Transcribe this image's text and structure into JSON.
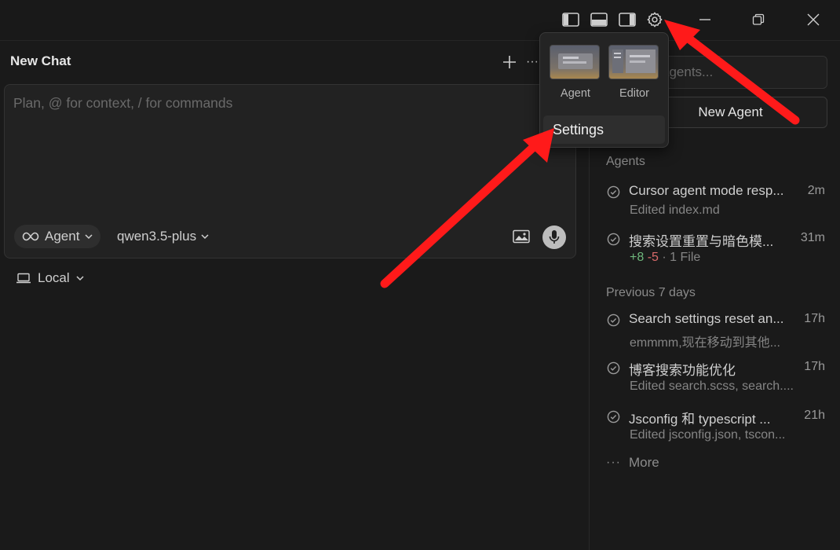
{
  "chat": {
    "title": "New Chat",
    "input_placeholder": "Plan, @ for context, / for commands",
    "mode_label": "Agent",
    "model_label": "qwen3.5-plus",
    "location_label": "Local"
  },
  "sidebar": {
    "search_placeholder": "agents...",
    "new_agent_label": "New Agent",
    "agents_section": "Agents",
    "previous_section": "Previous 7 days",
    "agents": [
      {
        "title": "Cursor agent mode resp...",
        "time": "2m",
        "sub": "Edited index.md"
      },
      {
        "title": "搜索设置重置与暗色模...",
        "time": "31m",
        "added": "+8",
        "removed": "-5",
        "files": "· 1 File"
      }
    ],
    "previous": [
      {
        "title": "Search settings reset an...",
        "time": "17h",
        "sub": "emmmm,现在移动到其他..."
      },
      {
        "title": "博客搜索功能优化",
        "time": "17h",
        "sub": "Edited search.scss, search...."
      },
      {
        "title": "Jsconfig 和 typescript ...",
        "time": "21h",
        "sub": "Edited jsconfig.json, tscon..."
      }
    ],
    "more_label": "More"
  },
  "popup": {
    "layouts": [
      {
        "label": "Agent"
      },
      {
        "label": "Editor"
      }
    ],
    "settings_label": "Settings"
  },
  "colors": {
    "background": "#1a1a1a",
    "annotation_arrow": "#ff1a1a",
    "added": "#6fb77c",
    "removed": "#d86a6a"
  }
}
